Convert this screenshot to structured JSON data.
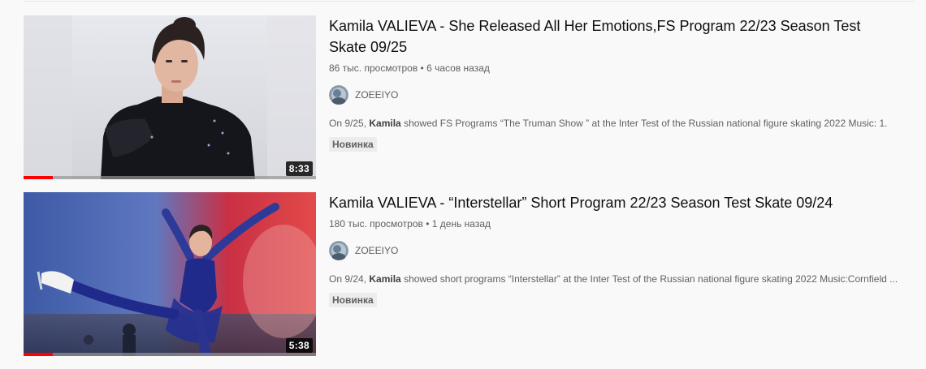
{
  "videos": [
    {
      "title_line1": "Kamila VALIEVA - She Released All Her Emotions,FS Program 22/23 Season Test",
      "title_line2": "Skate 09/25",
      "views": "86 тыс. просмотров",
      "separator": "•",
      "age": "6 часов назад",
      "channel": "ZOEEIYO",
      "desc_prefix": "On 9/25, ",
      "desc_bold": "Kamila",
      "desc_suffix": " showed FS Programs “The Truman Show ” at the Inter Test of the Russian national figure skating 2022 Music: 1.",
      "badge": "Новинка",
      "duration": "8:33",
      "watch_progress": 0.1
    },
    {
      "title_line1": "Kamila VALIEVA - “Interstellar” Short Program 22/23 Season Test Skate 09/24",
      "title_line2": "",
      "views": "180 тыс. просмотров",
      "separator": "•",
      "age": "1 день назад",
      "channel": "ZOEEIYO",
      "desc_prefix": "On 9/24, ",
      "desc_bold": "Kamila",
      "desc_suffix": " showed short programs “Interstellar” at the Inter Test of the Russian national figure skating 2022 Music:Cornfield ...",
      "badge": "Новинка",
      "duration": "5:38",
      "watch_progress": 0.1
    }
  ],
  "colors": {
    "background": "#f9f9f9",
    "title": "#0f0f0f",
    "secondary_text": "#606060",
    "progress_watched": "#ff0000",
    "badge_bg": "#ececec"
  },
  "icons": {
    "avatar": "channel-avatar-icon"
  }
}
